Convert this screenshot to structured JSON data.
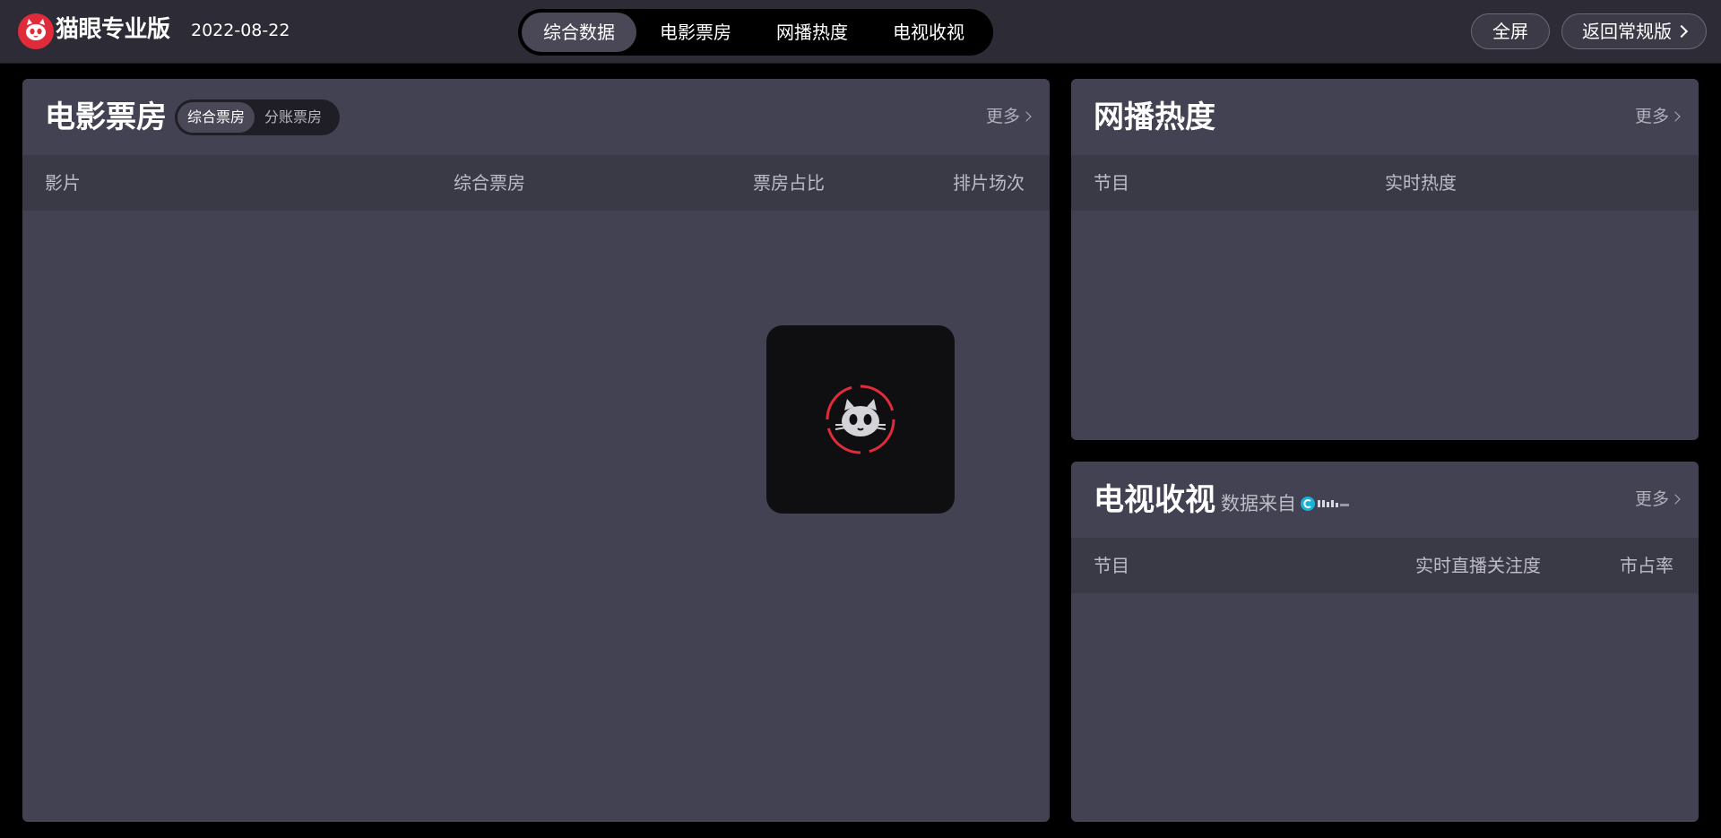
{
  "header": {
    "brand": "猫眼专业版",
    "date": "2022-08-22",
    "nav_tabs": [
      {
        "label": "综合数据",
        "active": true
      },
      {
        "label": "电影票房",
        "active": false
      },
      {
        "label": "网播热度",
        "active": false
      },
      {
        "label": "电视收视",
        "active": false
      }
    ],
    "fullscreen_label": "全屏",
    "back_label": "返回常规版"
  },
  "box_office": {
    "title": "电影票房",
    "toggle": [
      {
        "label": "综合票房",
        "active": true
      },
      {
        "label": "分账票房",
        "active": false
      }
    ],
    "more_label": "更多",
    "columns": [
      "影片",
      "综合票房",
      "票房占比",
      "排片场次"
    ]
  },
  "web_heat": {
    "title": "网播热度",
    "more_label": "更多",
    "columns": [
      "节目",
      "实时热度"
    ]
  },
  "tv_ratings": {
    "title": "电视收视",
    "source_label": "数据来自",
    "more_label": "更多",
    "columns": [
      "节目",
      "实时直播关注度",
      "市占率"
    ]
  },
  "colors": {
    "accent_red": "#e02c3a",
    "panel": "#434252",
    "header": "#2d2c36",
    "active_tab": "#4a4857",
    "source_logo": "#18b4d8"
  },
  "icons": {
    "logo": "maoyan-cat-logo",
    "loading": "cat-loading-spinner",
    "more": "chevron-right-icon",
    "source_logo": "cvb-source-logo"
  }
}
